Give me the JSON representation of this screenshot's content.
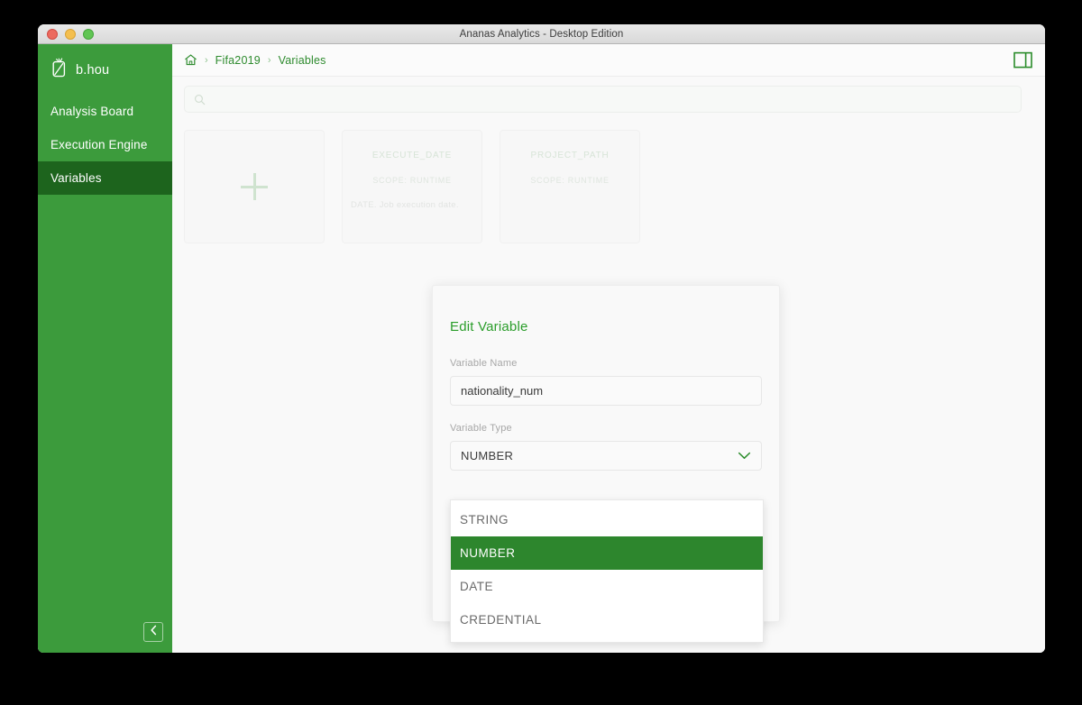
{
  "window": {
    "title": "Ananas Analytics - Desktop Edition",
    "traffic_lights": [
      "close-red",
      "minimize-yellow",
      "maximize-green"
    ]
  },
  "sidebar": {
    "brand": {
      "icon": "pineapple-icon",
      "name": "b.hou"
    },
    "items": [
      {
        "label": "Analysis Board",
        "active": false
      },
      {
        "label": "Execution Engine",
        "active": false
      },
      {
        "label": "Variables",
        "active": true
      }
    ],
    "collapse_icon": "chevron-left-icon",
    "bg_color": "#3c9b3c",
    "active_color": "#1d641d"
  },
  "topbar": {
    "home_icon": "home-icon",
    "breadcrumbs": [
      "Fifa2019",
      "Variables"
    ],
    "separator": "›",
    "panel_toggle_icon": "split-panel-icon",
    "accent_color": "#2e8b2e"
  },
  "search": {
    "icon": "search-icon",
    "value": "",
    "placeholder": ""
  },
  "cards": [
    {
      "type": "add",
      "icon": "plus-icon",
      "title": "",
      "scope": "",
      "description": ""
    },
    {
      "type": "variable",
      "title": "EXECUTE_DATE",
      "scope": "SCOPE: RUNTIME",
      "description": "DATE. Job execution date."
    },
    {
      "type": "variable",
      "title": "PROJECT_PATH",
      "scope": "SCOPE: RUNTIME",
      "description": ""
    }
  ],
  "modal": {
    "title": "Edit Variable",
    "name_label": "Variable Name",
    "name_value": "nationality_num",
    "name_placeholder": "",
    "type_label": "Variable Type",
    "type_value": "NUMBER",
    "chevron_icon": "chevron-down-icon",
    "options": [
      {
        "label": "STRING",
        "selected": false
      },
      {
        "label": "NUMBER",
        "selected": true
      },
      {
        "label": "DATE",
        "selected": false
      },
      {
        "label": "CREDENTIAL",
        "selected": false
      }
    ],
    "selected_bg": "#2d862d",
    "title_color": "#2a9d2a"
  }
}
